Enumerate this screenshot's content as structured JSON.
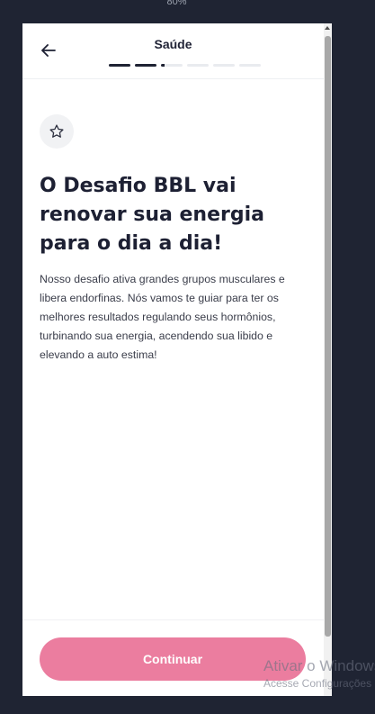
{
  "zoom_level": "80%",
  "header": {
    "title": "Saúde",
    "back_icon": "arrow-left-icon",
    "progress": {
      "total_steps": 6,
      "completed_steps": 2,
      "current_step_fraction": 0.15
    }
  },
  "content": {
    "badge_icon": "star-outline-icon",
    "headline": "O Desafio BBL vai renovar sua energia para o dia a dia!",
    "body": "Nosso desafio ativa grandes grupos musculares e libera endorfinas. Nós vamos te guiar para ter os melhores resultados regulando seus hormônios, turbinando sua energia, acendendo sua libido e elevando a auto estima!"
  },
  "footer": {
    "continue_label": "Continuar"
  },
  "watermark": {
    "title": "Ativar o Windows",
    "subtitle": "Acesse Configurações"
  },
  "colors": {
    "background": "#1f2433",
    "accent": "#eb7d9f",
    "text_dark": "#1d2033"
  }
}
